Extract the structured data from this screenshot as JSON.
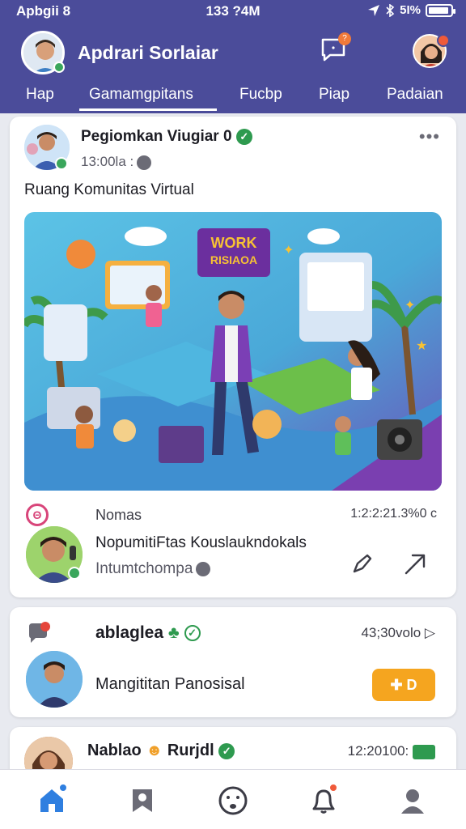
{
  "status_bar": {
    "left": "Apbgii 8",
    "center": "133 ?4M",
    "right": "5I%"
  },
  "header": {
    "title": "Apdrari Sorlaiar"
  },
  "tabs": [
    {
      "label": "Hap"
    },
    {
      "label": "Gamamgpitans",
      "active": true
    },
    {
      "label": "Fucbp"
    },
    {
      "label": "Piap"
    },
    {
      "label": "Padaian"
    }
  ],
  "post": {
    "author": "Pegiomkan Viugiar 0",
    "time": "13:00la :",
    "text": "Ruang Komunitas Virtual",
    "image_sign": "WORK\nRISIAOA",
    "reaction_label": "Nomas",
    "reaction_time": "1:2:2:21.3%0 c",
    "comment_text": "NopumitiFtas Kouslaukndokals",
    "comment_sub": "Intumtchompa"
  },
  "card2": {
    "title": "ablaglea",
    "time": "43;30volo",
    "text": "Mangititan Panosisal",
    "button_label": "✚ D"
  },
  "card3": {
    "title": "Nablao",
    "title2": "Rurjdl",
    "time": "12:20100:"
  },
  "colors": {
    "header": "#4b4c9a",
    "accent_orange": "#f5a51f",
    "verified_green": "#2e9a4f",
    "nav_active": "#2f7fe0"
  }
}
